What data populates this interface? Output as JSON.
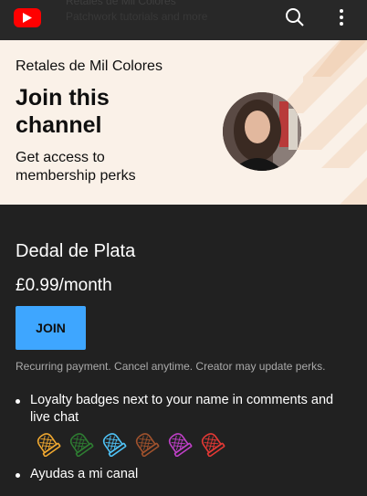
{
  "topbar": {
    "logo_icon": "youtube-logo-icon",
    "ghost_title": "Retales de Mil Colores",
    "ghost_subtitle": "Patchwork tutorials and more",
    "search_icon": "search-icon",
    "more_icon": "more-vertical-icon"
  },
  "hero": {
    "channel_name": "Retales de Mil Colores",
    "title": "Join this channel",
    "subtitle": "Get access to membership perks"
  },
  "tier": {
    "name": "Dedal de Plata",
    "price": "£0.99/month",
    "join_label": "JOIN",
    "disclaimer": "Recurring payment. Cancel anytime. Creator may update perks."
  },
  "perks": [
    {
      "text": "Loyalty badges next to your name in comments and live chat"
    },
    {
      "text": "Ayudas a mi canal"
    }
  ],
  "badge_colors": [
    "#f0a830",
    "#2e7d32",
    "#4fc3f7",
    "#a0522d",
    "#c040c8",
    "#e53935"
  ],
  "colors": {
    "accent": "#3ea6ff",
    "hero_bg": "#faf1e8",
    "page_bg": "#212121"
  }
}
